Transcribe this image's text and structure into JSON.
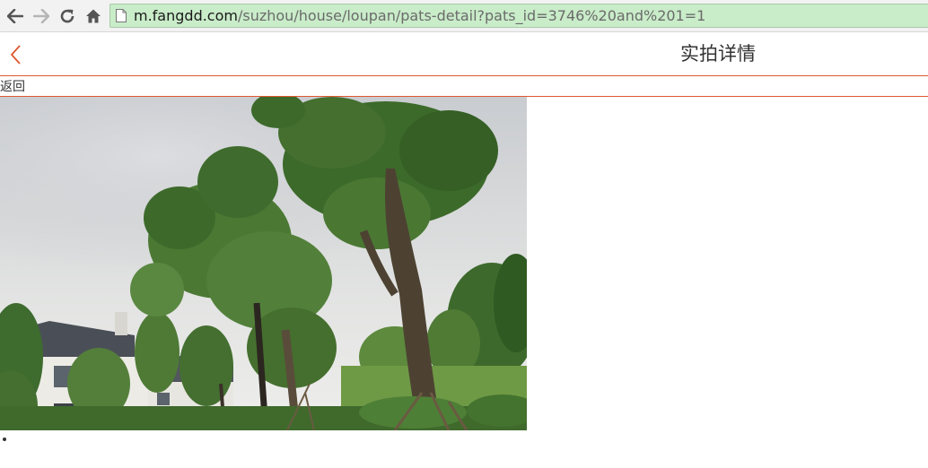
{
  "browser": {
    "url_host": "m.fangdd.com",
    "url_path": "/suzhou/house/loupan/pats-detail?pats_id=3746%20and%201=1",
    "icons": [
      "back-arrow-icon",
      "forward-arrow-icon",
      "reload-icon",
      "home-icon",
      "page-icon"
    ]
  },
  "header": {
    "title": "实拍详情",
    "back_icon": "chevron-left-icon",
    "back_label": "返回",
    "accent_color": "#e0582f"
  },
  "content": {
    "photo_alt": "tree-photo",
    "trailing_mark": "."
  }
}
